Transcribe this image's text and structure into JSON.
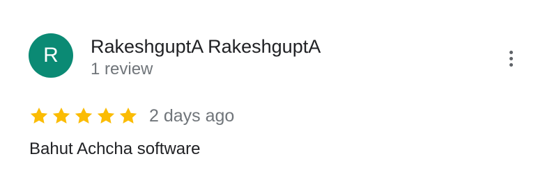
{
  "review": {
    "avatar": {
      "initial": "R",
      "color": "#0b8a74"
    },
    "reviewer_name": "RakeshguptA RakeshguptA",
    "review_count": "1 review",
    "more_options_icon": "more-vert-icon",
    "rating": {
      "value": 5,
      "max": 5,
      "star_color": "#fbbc04"
    },
    "date": "2 days ago",
    "text": "Bahut Achcha software"
  },
  "colors": {
    "secondary_text": "#70757a",
    "primary_text": "#202124",
    "menu_icon": "#5f6368"
  }
}
